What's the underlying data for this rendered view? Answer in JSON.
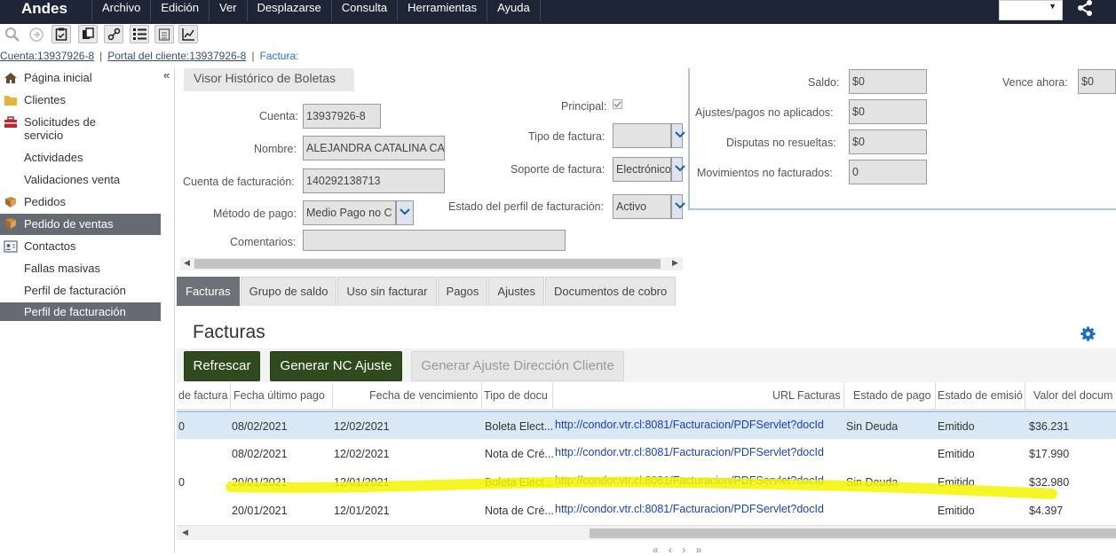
{
  "app": {
    "logo": "Andes"
  },
  "menu": [
    "Archivo",
    "Edición",
    "Ver",
    "Desplazarse",
    "Consulta",
    "Herramientas",
    "Ayuda"
  ],
  "toolbar": {
    "icons": [
      "search-icon",
      "forward-icon",
      "clipboard-check-icon",
      "copy-icon",
      "link-icon",
      "list-icon",
      "report-icon",
      "chart-icon"
    ]
  },
  "breadcrumb": {
    "cuenta": "Cuenta:13937926-8",
    "portal": "Portal del cliente:13937926-8",
    "current": "Factura:"
  },
  "sidebar": {
    "collapse": "«",
    "items": [
      {
        "label": "Página inicial",
        "icon": "home-icon"
      },
      {
        "label": "Clientes",
        "icon": "folder-icon"
      },
      {
        "label": "Solicitudes de",
        "label2": "servicio",
        "icon": "toolbox-icon"
      },
      {
        "label": "Actividades"
      },
      {
        "label": "Validaciones venta"
      },
      {
        "label": "Pedidos",
        "icon": "order-icon"
      },
      {
        "label": "Pedido de ventas",
        "icon": "order-icon",
        "active": true
      },
      {
        "label": "Contactos",
        "icon": "contacts-icon"
      },
      {
        "label": "Fallas masivas"
      },
      {
        "label": "Perfil de facturación"
      },
      {
        "label": "Perfil de facturación",
        "active": true
      }
    ]
  },
  "detail": {
    "tab": "Visor Histórico de Boletas",
    "cuenta_label": "Cuenta:",
    "cuenta": "13937926-8",
    "nombre_label": "Nombre:",
    "nombre": "ALEJANDRA CATALINA CA",
    "cuenta_fact_label": "Cuenta de facturación:",
    "cuenta_fact": "140292138713",
    "metodo_label": "Método de pago:",
    "metodo": "Medio Pago no C",
    "comentarios_label": "Comentarios:",
    "comentarios": "",
    "principal_label": "Principal:",
    "tipo_factura_label": "Tipo de factura:",
    "tipo_factura": "",
    "soporte_label": "Soporte de factura:",
    "soporte": "Electrónico",
    "estado_perfil_label": "Estado del perfil de facturación:",
    "estado_perfil": "Activo"
  },
  "summary": {
    "saldo_label": "Saldo:",
    "saldo": "$0",
    "vence_label": "Vence ahora:",
    "vence": "$0",
    "ajustes_label": "Ajustes/pagos no aplicados:",
    "ajustes": "$0",
    "disputas_label": "Disputas no resueltas:",
    "disputas": "$0",
    "movimientos_label": "Movimientos no facturados:",
    "movimientos": "0"
  },
  "tabs": [
    "Facturas",
    "Grupo de saldo",
    "Uso sin facturar",
    "Pagos",
    "Ajustes",
    "Documentos de cobro"
  ],
  "facturas": {
    "title": "Facturas",
    "btn_refrescar": "Refrescar",
    "btn_generar_nc": "Generar NC Ajuste",
    "btn_generar_dir": "Generar Ajuste Dirección Cliente",
    "columns": [
      "de factura",
      "Fecha último pago",
      "Fecha de vencimiento",
      "Tipo de docu",
      "URL Facturas",
      "Estado de pago",
      "Estado de emisió",
      "Valor del docum"
    ],
    "rows": [
      {
        "num": "0",
        "fecha_pago": "08/02/2021",
        "vencimiento": "12/02/2021",
        "tipo": "Boleta Elect...",
        "url": "http://condor.vtr.cl:8081/Facturacion/PDFServlet?docId",
        "estado_pago": "Sin Deuda",
        "estado_emision": "Emitido",
        "valor": "$36.231"
      },
      {
        "num": "",
        "fecha_pago": "08/02/2021",
        "vencimiento": "12/02/2021",
        "tipo": "Nota de Cré...",
        "url": "http://condor.vtr.cl:8081/Facturacion/PDFServlet?docId",
        "estado_pago": "",
        "estado_emision": "Emitido",
        "valor": "$17.990"
      },
      {
        "num": "0",
        "fecha_pago": "20/01/2021",
        "vencimiento": "12/01/2021",
        "tipo": "Boleta Elect...",
        "url": "http://condor.vtr.cl:8081/Facturacion/PDFServlet?docId",
        "estado_pago": "Sin Deuda",
        "estado_emision": "Emitido",
        "valor": "$32.980"
      },
      {
        "num": "",
        "fecha_pago": "20/01/2021",
        "vencimiento": "12/01/2021",
        "tipo": "Nota de Cré...",
        "url": "http://condor.vtr.cl:8081/Facturacion/PDFServlet?docId",
        "estado_pago": "",
        "estado_emision": "Emitido",
        "valor": "$4.397"
      }
    ],
    "pager": "« ‹ › »"
  },
  "colors": {
    "menubar": "#1d2536",
    "green_button": "#2f4a1d",
    "highlight": "#f5f500",
    "link": "#1a3fbf"
  }
}
